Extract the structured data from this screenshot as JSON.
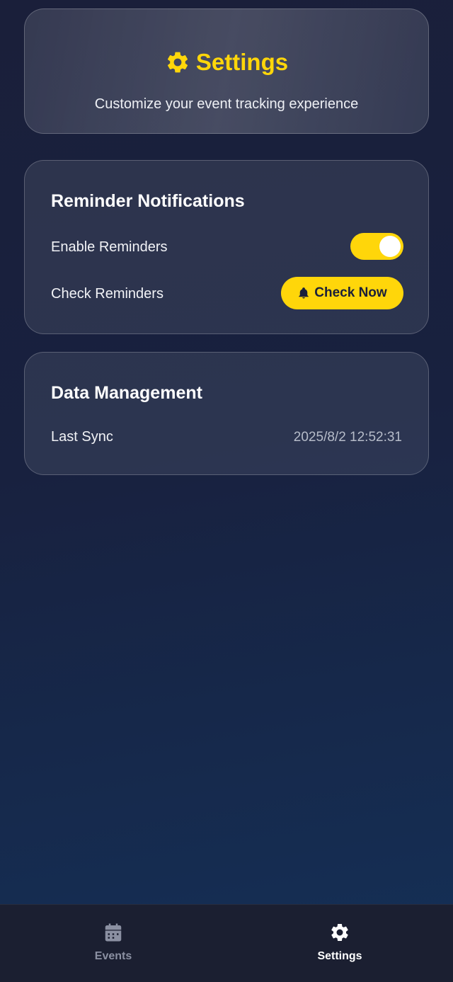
{
  "header": {
    "title": "Settings",
    "subtitle": "Customize your event tracking experience",
    "icon": "gear-icon",
    "accent_color": "#ffd60a"
  },
  "reminders": {
    "title": "Reminder Notifications",
    "enable_label": "Enable Reminders",
    "enable_on": true,
    "check_label": "Check Reminders",
    "check_button": "Check Now",
    "check_button_icon": "bell-icon"
  },
  "data_management": {
    "title": "Data Management",
    "last_sync_label": "Last Sync",
    "last_sync_value": "2025/8/2 12:52:31"
  },
  "nav": {
    "items": [
      {
        "label": "Events",
        "icon": "calendar-icon",
        "active": false
      },
      {
        "label": "Settings",
        "icon": "gear-icon",
        "active": true
      }
    ]
  }
}
